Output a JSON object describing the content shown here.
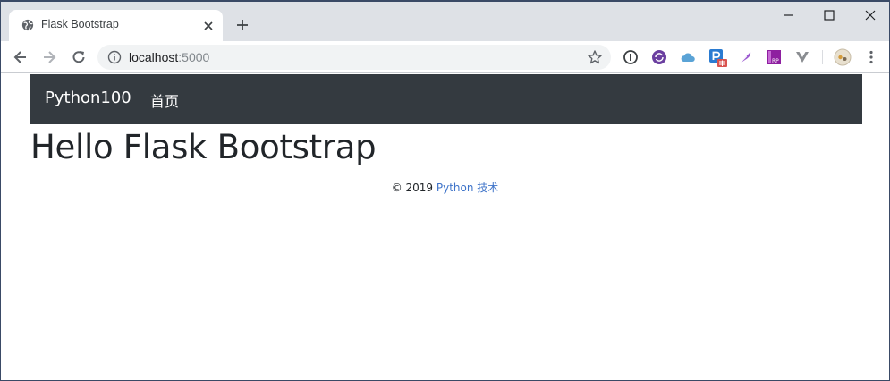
{
  "tab": {
    "title": "Flask Bootstrap",
    "favicon": "globe-icon"
  },
  "address_bar": {
    "host": "localhost",
    "port": ":5000"
  },
  "extensions": [
    "password-manager-icon",
    "refresh-extension-icon",
    "cloud-extension-icon",
    "p-extension-icon",
    "feather-extension-icon",
    "rp-extension-icon",
    "v-extension-icon",
    "profile-avatar-icon",
    "menu-icon"
  ],
  "page": {
    "navbar": {
      "brand": "Python100",
      "links": [
        "首页"
      ]
    },
    "heading": "Hello Flask Bootstrap",
    "footer": {
      "copyright": "© 2019 ",
      "link_text": "Python 技术"
    }
  },
  "colors": {
    "navbar_bg": "#343a40",
    "link": "#3f74c9",
    "tabstrip_bg": "#dee1e6"
  }
}
